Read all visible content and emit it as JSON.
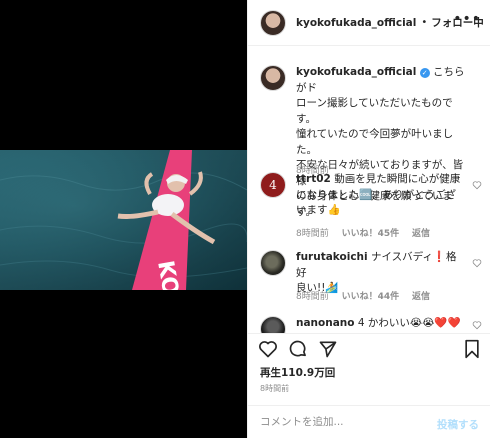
{
  "post_header": {
    "username": "kyokofukada_official",
    "separator": "•",
    "follow_label": "フォロー中",
    "more_label": "•••"
  },
  "caption": {
    "username": "kyokofukada_official",
    "verified_mark": "✓",
    "line1": "こちらがド",
    "line2": "ローン撮影していただいたものです。",
    "line3": "憧れていたので今回夢が叶いました。",
    "line4": "不安な日々が続いておりますが、皆様",
    "line5": "のお身体と心の健康を願っています。",
    "time": "8時間前"
  },
  "comments": [
    {
      "username": "ttrt02",
      "text1": "動画を見た瞬間に心が健康",
      "text2": "になりました🆒。ありがとうござ",
      "text3": "います👍",
      "time": "8時間前",
      "likes": "いいね！45件",
      "reply": "返信"
    },
    {
      "username": "furutakoichi",
      "text1": "ナイスバディ❗️格好",
      "text2": "良い!!🏄",
      "time": "8時間前",
      "likes": "いいね！44件",
      "reply": "返信"
    },
    {
      "username": "nanonano",
      "text1": "4 かわいい😭😭❤️❤️"
    }
  ],
  "stats": {
    "views": "再生110.9万回",
    "ago": "8時間前"
  },
  "composer": {
    "placeholder": "コメントを追加...",
    "post_label": "投稿する"
  },
  "colors": {
    "accent_blue": "#3897f0",
    "post_disabled": "#b2dffc",
    "board_pink": "#e8407a"
  }
}
